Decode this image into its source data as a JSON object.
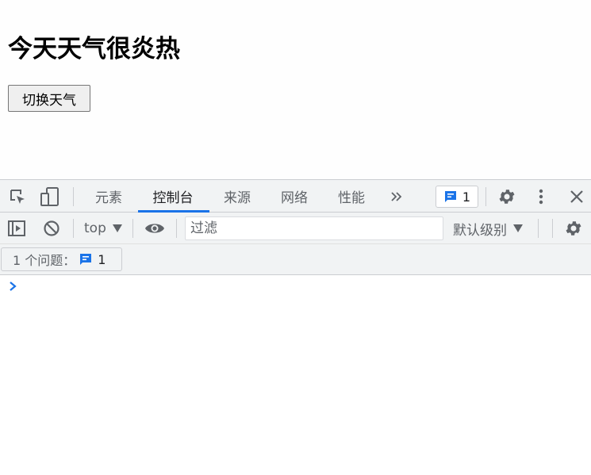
{
  "page": {
    "title": "今天天气很炎热",
    "toggle_label": "切换天气"
  },
  "devtools": {
    "tabs": [
      {
        "label": "元素",
        "active": false
      },
      {
        "label": "控制台",
        "active": true
      },
      {
        "label": "来源",
        "active": false
      },
      {
        "label": "网络",
        "active": false
      },
      {
        "label": "性能",
        "active": false
      }
    ],
    "more_tabs_icon": "chevron-double-right-icon",
    "issues_badge_count": "1",
    "toolbar": {
      "context": "top",
      "filter_placeholder": "过滤",
      "log_level": "默认级别"
    },
    "issues_bar": {
      "label": "1 个问题：",
      "count": "1"
    },
    "colors": {
      "accent": "#1a73e8",
      "panel_bg": "#f1f3f4",
      "icon": "#5f6368"
    }
  }
}
